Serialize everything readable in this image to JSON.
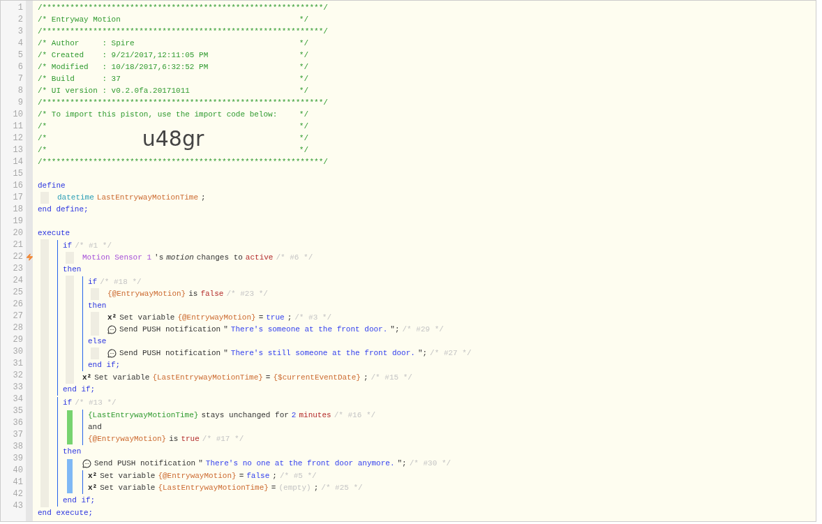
{
  "line_numbers": [
    {
      "label": "1",
      "trigger": false
    },
    {
      "label": "2",
      "trigger": false
    },
    {
      "label": "3",
      "trigger": false
    },
    {
      "label": "4",
      "trigger": false
    },
    {
      "label": "5",
      "trigger": false
    },
    {
      "label": "6",
      "trigger": false
    },
    {
      "label": "7",
      "trigger": false
    },
    {
      "label": "8",
      "trigger": false
    },
    {
      "label": "9",
      "trigger": false
    },
    {
      "label": "10",
      "trigger": false
    },
    {
      "label": "11",
      "trigger": false
    },
    {
      "label": "12",
      "trigger": false
    },
    {
      "label": "13",
      "trigger": false
    },
    {
      "label": "14",
      "trigger": false
    },
    {
      "label": "15",
      "trigger": false
    },
    {
      "label": "16",
      "trigger": false
    },
    {
      "label": "17",
      "trigger": false
    },
    {
      "label": "18",
      "trigger": false
    },
    {
      "label": "19",
      "trigger": false
    },
    {
      "label": "20",
      "trigger": false
    },
    {
      "label": "21",
      "trigger": false
    },
    {
      "label": "22",
      "trigger": true
    },
    {
      "label": "23",
      "trigger": false
    },
    {
      "label": "24",
      "trigger": false
    },
    {
      "label": "25",
      "trigger": false
    },
    {
      "label": "26",
      "trigger": false
    },
    {
      "label": "27",
      "trigger": false
    },
    {
      "label": "28",
      "trigger": false
    },
    {
      "label": "29",
      "trigger": false
    },
    {
      "label": "30",
      "trigger": false
    },
    {
      "label": "31",
      "trigger": false
    },
    {
      "label": "32",
      "trigger": false
    },
    {
      "label": "33",
      "trigger": false
    },
    {
      "label": "34",
      "trigger": false
    },
    {
      "label": "35",
      "trigger": false
    },
    {
      "label": "36",
      "trigger": false
    },
    {
      "label": "37",
      "trigger": false
    },
    {
      "label": "38",
      "trigger": false
    },
    {
      "label": "39",
      "trigger": false
    },
    {
      "label": "40",
      "trigger": false
    },
    {
      "label": "41",
      "trigger": false
    },
    {
      "label": "42",
      "trigger": false
    },
    {
      "label": "43",
      "trigger": false
    }
  ],
  "code": [
    {
      "kind": "line",
      "segments": [
        {
          "kind": "comment",
          "text": "/*************************************************************/"
        }
      ]
    },
    {
      "kind": "header",
      "segments": [
        {
          "kind": "comment",
          "text": "/* Entryway Motion"
        },
        {
          "kind": "comment",
          "text": "*/"
        }
      ]
    },
    {
      "kind": "line",
      "segments": [
        {
          "kind": "comment",
          "text": "/*************************************************************/"
        }
      ]
    },
    {
      "kind": "header",
      "segments": [
        {
          "kind": "comment",
          "text": "/* Author     : Spire"
        },
        {
          "kind": "comment",
          "text": "*/"
        }
      ]
    },
    {
      "kind": "header",
      "segments": [
        {
          "kind": "comment",
          "text": "/* Created    : 9/21/2017,12:11:05 PM"
        },
        {
          "kind": "comment",
          "text": "*/"
        }
      ]
    },
    {
      "kind": "header",
      "segments": [
        {
          "kind": "comment",
          "text": "/* Modified   : 10/18/2017,6:32:52 PM"
        },
        {
          "kind": "comment",
          "text": "*/"
        }
      ]
    },
    {
      "kind": "header",
      "segments": [
        {
          "kind": "comment",
          "text": "/* Build      : 37"
        },
        {
          "kind": "comment",
          "text": "*/"
        }
      ]
    },
    {
      "kind": "header",
      "segments": [
        {
          "kind": "comment",
          "text": "/* UI version : v0.2.0fa.20171011"
        },
        {
          "kind": "comment",
          "text": "*/"
        }
      ]
    },
    {
      "kind": "line",
      "segments": [
        {
          "kind": "comment",
          "text": "/*************************************************************/"
        }
      ]
    },
    {
      "kind": "header",
      "segments": [
        {
          "kind": "comment",
          "text": "/* To import this piston, use the import code below:"
        },
        {
          "kind": "comment",
          "text": "*/"
        }
      ]
    },
    {
      "kind": "header",
      "segments": [
        {
          "kind": "comment",
          "text": "/*"
        },
        {
          "kind": "comment",
          "text": "*/"
        }
      ]
    },
    {
      "kind": "header",
      "segments": [
        {
          "kind": "comment",
          "text": "/*"
        },
        {
          "kind": "import_code",
          "text": "u48gr"
        },
        {
          "kind": "comment",
          "text": "*/"
        }
      ]
    },
    {
      "kind": "header",
      "segments": [
        {
          "kind": "comment",
          "text": "/*"
        },
        {
          "kind": "comment",
          "text": "*/"
        }
      ]
    },
    {
      "kind": "line",
      "segments": [
        {
          "kind": "comment",
          "text": "/*************************************************************/"
        }
      ]
    },
    {
      "kind": "line"
    },
    {
      "kind": "line",
      "segments": [
        {
          "kind": "keyword",
          "text": "define"
        }
      ],
      "children": [
        {
          "kind": "line",
          "segments": [
            {
              "kind": "type",
              "text": "datetime"
            },
            {
              "kind": "variable",
              "text": "LastEntrywayMotionTime"
            },
            {
              "kind": "plain",
              "text": ";"
            }
          ]
        }
      ]
    },
    {
      "kind": "line",
      "segments": [
        {
          "kind": "keyword",
          "text": "end define;"
        }
      ]
    },
    {
      "kind": "line"
    },
    {
      "kind": "line",
      "segments": [
        {
          "kind": "keyword",
          "text": "execute"
        }
      ],
      "children": [
        {
          "kind": "block",
          "children": [
            {
              "kind": "line",
              "segments": [
                {
                  "kind": "keyword",
                  "text": "if"
                },
                {
                  "kind": "note",
                  "text": "/* #1 */"
                }
              ],
              "children": [
                {
                  "kind": "line",
                  "segments": [
                    {
                      "kind": "device",
                      "text": "Motion Sensor 1"
                    },
                    {
                      "kind": "plain",
                      "text": "'s"
                    },
                    {
                      "kind": "attribute",
                      "text": "motion"
                    },
                    {
                      "kind": "plain",
                      "text": "changes to"
                    },
                    {
                      "kind": "value",
                      "text": "active"
                    },
                    {
                      "kind": "note",
                      "text": "/* #6 */"
                    }
                  ]
                }
              ]
            },
            {
              "kind": "line",
              "segments": [
                {
                  "kind": "keyword",
                  "text": "then"
                }
              ],
              "children": [
                {
                  "kind": "block",
                  "children": [
                    {
                      "kind": "line",
                      "segments": [
                        {
                          "kind": "keyword",
                          "text": "if"
                        },
                        {
                          "kind": "note",
                          "text": "/* #18 */"
                        }
                      ],
                      "children": [
                        {
                          "kind": "line",
                          "segments": [
                            {
                              "kind": "variable",
                              "text": "{@EntrywayMotion}"
                            },
                            {
                              "kind": "plain",
                              "text": "is"
                            },
                            {
                              "kind": "value",
                              "text": "false"
                            },
                            {
                              "kind": "note",
                              "text": "/* #23 */"
                            }
                          ]
                        }
                      ]
                    },
                    {
                      "kind": "line",
                      "segments": [
                        {
                          "kind": "keyword",
                          "text": "then"
                        }
                      ],
                      "children": [
                        {
                          "kind": "line",
                          "segments": [
                            {
                              "kind": "symbol",
                              "text": "x²"
                            },
                            {
                              "kind": "plain",
                              "text": "Set variable"
                            },
                            {
                              "kind": "variable",
                              "text": "{@EntrywayMotion}"
                            },
                            {
                              "kind": "plain",
                              "text": "="
                            },
                            {
                              "kind": "string",
                              "text": "true"
                            },
                            {
                              "kind": "plain",
                              "text": ";"
                            },
                            {
                              "kind": "note",
                              "text": "/* #3 */"
                            }
                          ]
                        },
                        {
                          "kind": "line",
                          "segments": [
                            {
                              "kind": "chat_icon"
                            },
                            {
                              "kind": "plain",
                              "text": "Send PUSH notification"
                            },
                            {
                              "kind": "plain",
                              "text": "\""
                            },
                            {
                              "kind": "string",
                              "text": "There's someone at the front door."
                            },
                            {
                              "kind": "plain",
                              "text": "\";"
                            },
                            {
                              "kind": "note",
                              "text": "/* #29 */"
                            }
                          ]
                        }
                      ]
                    },
                    {
                      "kind": "line",
                      "segments": [
                        {
                          "kind": "keyword",
                          "text": "else"
                        }
                      ],
                      "children": [
                        {
                          "kind": "line",
                          "segments": [
                            {
                              "kind": "chat_icon"
                            },
                            {
                              "kind": "plain",
                              "text": "Send PUSH notification"
                            },
                            {
                              "kind": "plain",
                              "text": "\""
                            },
                            {
                              "kind": "string",
                              "text": "There's still someone at the front door."
                            },
                            {
                              "kind": "plain",
                              "text": "\";"
                            },
                            {
                              "kind": "note",
                              "text": "/* #27 */"
                            }
                          ]
                        }
                      ]
                    },
                    {
                      "kind": "line",
                      "segments": [
                        {
                          "kind": "keyword",
                          "text": "end if;"
                        }
                      ]
                    }
                  ]
                },
                {
                  "kind": "line",
                  "segments": [
                    {
                      "kind": "symbol",
                      "text": "x²"
                    },
                    {
                      "kind": "plain",
                      "text": "Set variable"
                    },
                    {
                      "kind": "variable",
                      "text": "{LastEntrywayMotionTime}"
                    },
                    {
                      "kind": "plain",
                      "text": "="
                    },
                    {
                      "kind": "variable",
                      "text": "{$currentEventDate}"
                    },
                    {
                      "kind": "plain",
                      "text": ";"
                    },
                    {
                      "kind": "note",
                      "text": "/* #15 */"
                    }
                  ]
                }
              ]
            },
            {
              "kind": "line",
              "segments": [
                {
                  "kind": "keyword",
                  "text": "end if;"
                }
              ]
            }
          ]
        },
        {
          "kind": "block",
          "children": [
            {
              "kind": "line",
              "color": "#77d36f",
              "segments": [
                {
                  "kind": "keyword",
                  "text": "if"
                },
                {
                  "kind": "note",
                  "text": "/* #13 */"
                }
              ],
              "children": [
                {
                  "kind": "block",
                  "children": [
                    {
                      "kind": "line",
                      "segments": [
                        {
                          "kind": "operand",
                          "text": "{LastEntrywayMotionTime}"
                        },
                        {
                          "kind": "plain",
                          "text": "stays unchanged for"
                        },
                        {
                          "kind": "string",
                          "text": "2"
                        },
                        {
                          "kind": "value",
                          "text": "minutes"
                        },
                        {
                          "kind": "note",
                          "text": "/* #16 */"
                        }
                      ]
                    },
                    {
                      "kind": "line",
                      "segments": [
                        {
                          "kind": "plain",
                          "text": "and"
                        }
                      ]
                    },
                    {
                      "kind": "line",
                      "segments": [
                        {
                          "kind": "variable",
                          "text": "{@EntrywayMotion}"
                        },
                        {
                          "kind": "plain",
                          "text": "is"
                        },
                        {
                          "kind": "value",
                          "text": "true"
                        },
                        {
                          "kind": "note",
                          "text": "/* #17 */"
                        }
                      ]
                    }
                  ]
                }
              ]
            },
            {
              "kind": "line",
              "color": "#7fb8f5",
              "segments": [
                {
                  "kind": "keyword",
                  "text": "then"
                }
              ],
              "children": [
                {
                  "kind": "line",
                  "segments": [
                    {
                      "kind": "chat_icon"
                    },
                    {
                      "kind": "plain",
                      "text": "Send PUSH notification"
                    },
                    {
                      "kind": "plain",
                      "text": "\""
                    },
                    {
                      "kind": "string",
                      "text": "There's no one at the front door anymore."
                    },
                    {
                      "kind": "plain",
                      "text": "\";"
                    },
                    {
                      "kind": "note",
                      "text": "/* #30 */"
                    }
                  ]
                },
                {
                  "kind": "block",
                  "children": [
                    {
                      "kind": "line",
                      "segments": [
                        {
                          "kind": "symbol",
                          "text": "x²"
                        },
                        {
                          "kind": "plain",
                          "text": "Set variable"
                        },
                        {
                          "kind": "variable",
                          "text": "{@EntrywayMotion}"
                        },
                        {
                          "kind": "plain",
                          "text": "="
                        },
                        {
                          "kind": "string",
                          "text": "false"
                        },
                        {
                          "kind": "plain",
                          "text": ";"
                        },
                        {
                          "kind": "note",
                          "text": "/* #5 */"
                        }
                      ]
                    },
                    {
                      "kind": "line",
                      "segments": [
                        {
                          "kind": "symbol",
                          "text": "x²"
                        },
                        {
                          "kind": "plain",
                          "text": "Set variable"
                        },
                        {
                          "kind": "variable",
                          "text": "{LastEntrywayMotionTime}"
                        },
                        {
                          "kind": "plain",
                          "text": "="
                        },
                        {
                          "kind": "note",
                          "text": "(empty)"
                        },
                        {
                          "kind": "plain",
                          "text": ";"
                        },
                        {
                          "kind": "note",
                          "text": "/* #25 */"
                        }
                      ]
                    }
                  ]
                }
              ]
            },
            {
              "kind": "line",
              "segments": [
                {
                  "kind": "keyword",
                  "text": "end if;"
                }
              ]
            }
          ]
        }
      ]
    },
    {
      "kind": "line",
      "segments": [
        {
          "kind": "keyword",
          "text": "end execute;"
        }
      ]
    }
  ]
}
